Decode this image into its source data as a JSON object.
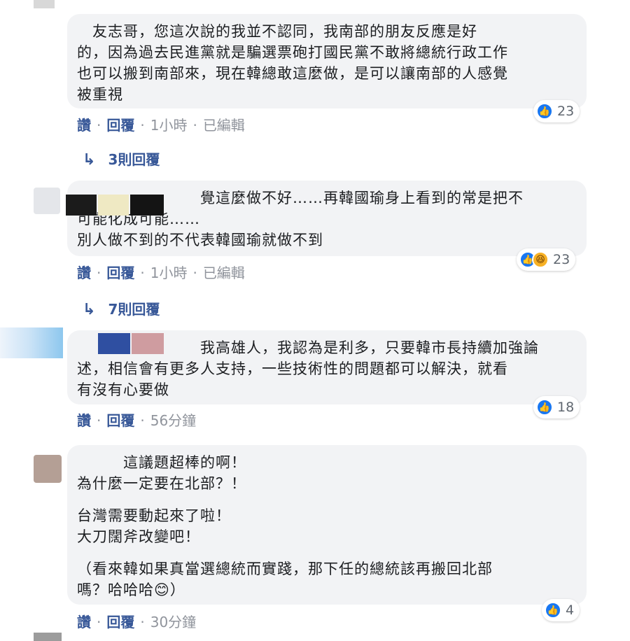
{
  "comments": [
    {
      "lines": [
        "　友志哥，您這次說的我並不認同，我南部的朋友反應是好",
        "的，因為過去民進黨就是騙選票砲打國民黨不敢將總統行政工作",
        "也可以搬到南部來，現在韓總敢這麼做，是可以讓南部的人感覺",
        "被重視"
      ],
      "like_label": "讚",
      "reply_label": "回覆",
      "time": "1小時",
      "edited": "已編輯",
      "reaction_count": "23",
      "replies_label": "3則回覆"
    },
    {
      "lines": [
        "　　　　　　　　覺這麼做不好……再韓國瑜身上看到的常是把不",
        "可能化成可能……",
        "別人做不到的不代表韓國瑜就做不到"
      ],
      "like_label": "讚",
      "reply_label": "回覆",
      "time": "1小時",
      "edited": "已編輯",
      "reaction_count": "23",
      "replies_label": "7則回覆"
    },
    {
      "lines": [
        "　　　　　　　　我高雄人，我認為是利多，只要韓市長持續加強論",
        "述，相信會有更多人支持，一些技術性的問題都可以解決，就看",
        "有沒有心要做"
      ],
      "like_label": "讚",
      "reply_label": "回覆",
      "time": "56分鐘",
      "reaction_count": "18"
    },
    {
      "lines": [
        "　　　這議題超棒的啊！",
        "為什麼一定要在北部？！",
        "",
        "台灣需要動起來了啦！",
        "大刀闊斧改變吧！",
        "",
        "（看來韓如果真當選總統而實踐，那下任的總統該再搬回北部",
        "嗎？哈哈哈😊）"
      ],
      "like_label": "讚",
      "reply_label": "回覆",
      "time": "30分鐘",
      "reaction_count": "4"
    }
  ],
  "colors": {
    "link": "#385898",
    "bubble": "#f2f3f5",
    "like": "#1877f2",
    "haha": "#f7b125"
  },
  "icons": {
    "like": "like-icon",
    "haha": "haha-icon",
    "reply_arrow": "reply-arrow-icon"
  }
}
